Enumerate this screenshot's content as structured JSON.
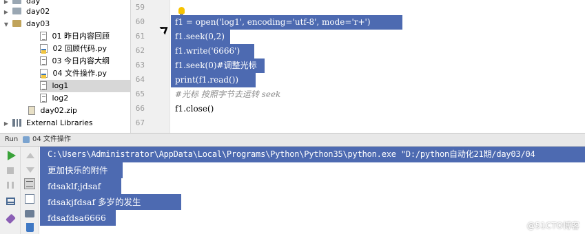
{
  "project_tree": {
    "items": [
      {
        "label": "day",
        "type": "folder-gray"
      },
      {
        "label": "day02",
        "type": "folder-gray"
      },
      {
        "label": "day03",
        "type": "folder"
      },
      {
        "label": "01 昨日内容回顾",
        "type": "txt"
      },
      {
        "label": "02 回顾代码.py",
        "type": "py"
      },
      {
        "label": "03 今日内容大纲",
        "type": "txt"
      },
      {
        "label": "04 文件操作.py",
        "type": "py"
      },
      {
        "label": "log1",
        "type": "txt"
      },
      {
        "label": "log2",
        "type": "txt"
      },
      {
        "label": "day02.zip",
        "type": "zip"
      },
      {
        "label": "External Libraries",
        "type": "lib"
      }
    ]
  },
  "editor": {
    "line_numbers": [
      "59",
      "60",
      "61",
      "62",
      "63",
      "64",
      "65",
      "66",
      "67"
    ],
    "lines": [
      "",
      "f1 = open('log1', encoding='utf-8', mode='r+')",
      "f1.seek(0,2)",
      "f1.write('6666')",
      "f1.seek(0)#调整光标",
      "print(f1.read())",
      "#光标 按照字节去运转 seek",
      "f1.close()",
      ""
    ]
  },
  "run_panel": {
    "label": "Run",
    "tab_label": "04 文件操作",
    "output": [
      "C:\\Users\\Administrator\\AppData\\Local\\Programs\\Python\\Python35\\python.exe \"D:/python自动化21期/day03/04",
      "更加快乐的附件",
      "fdsaklf;jdsaf",
      "fdsakjfdsaf 多岁的发生",
      "fdsafdsa6666"
    ]
  },
  "watermark": "@51CTO博客",
  "colors": {
    "selection": "#4d6ab1",
    "gutter": "#f0f0f0",
    "panel": "#efefef"
  }
}
